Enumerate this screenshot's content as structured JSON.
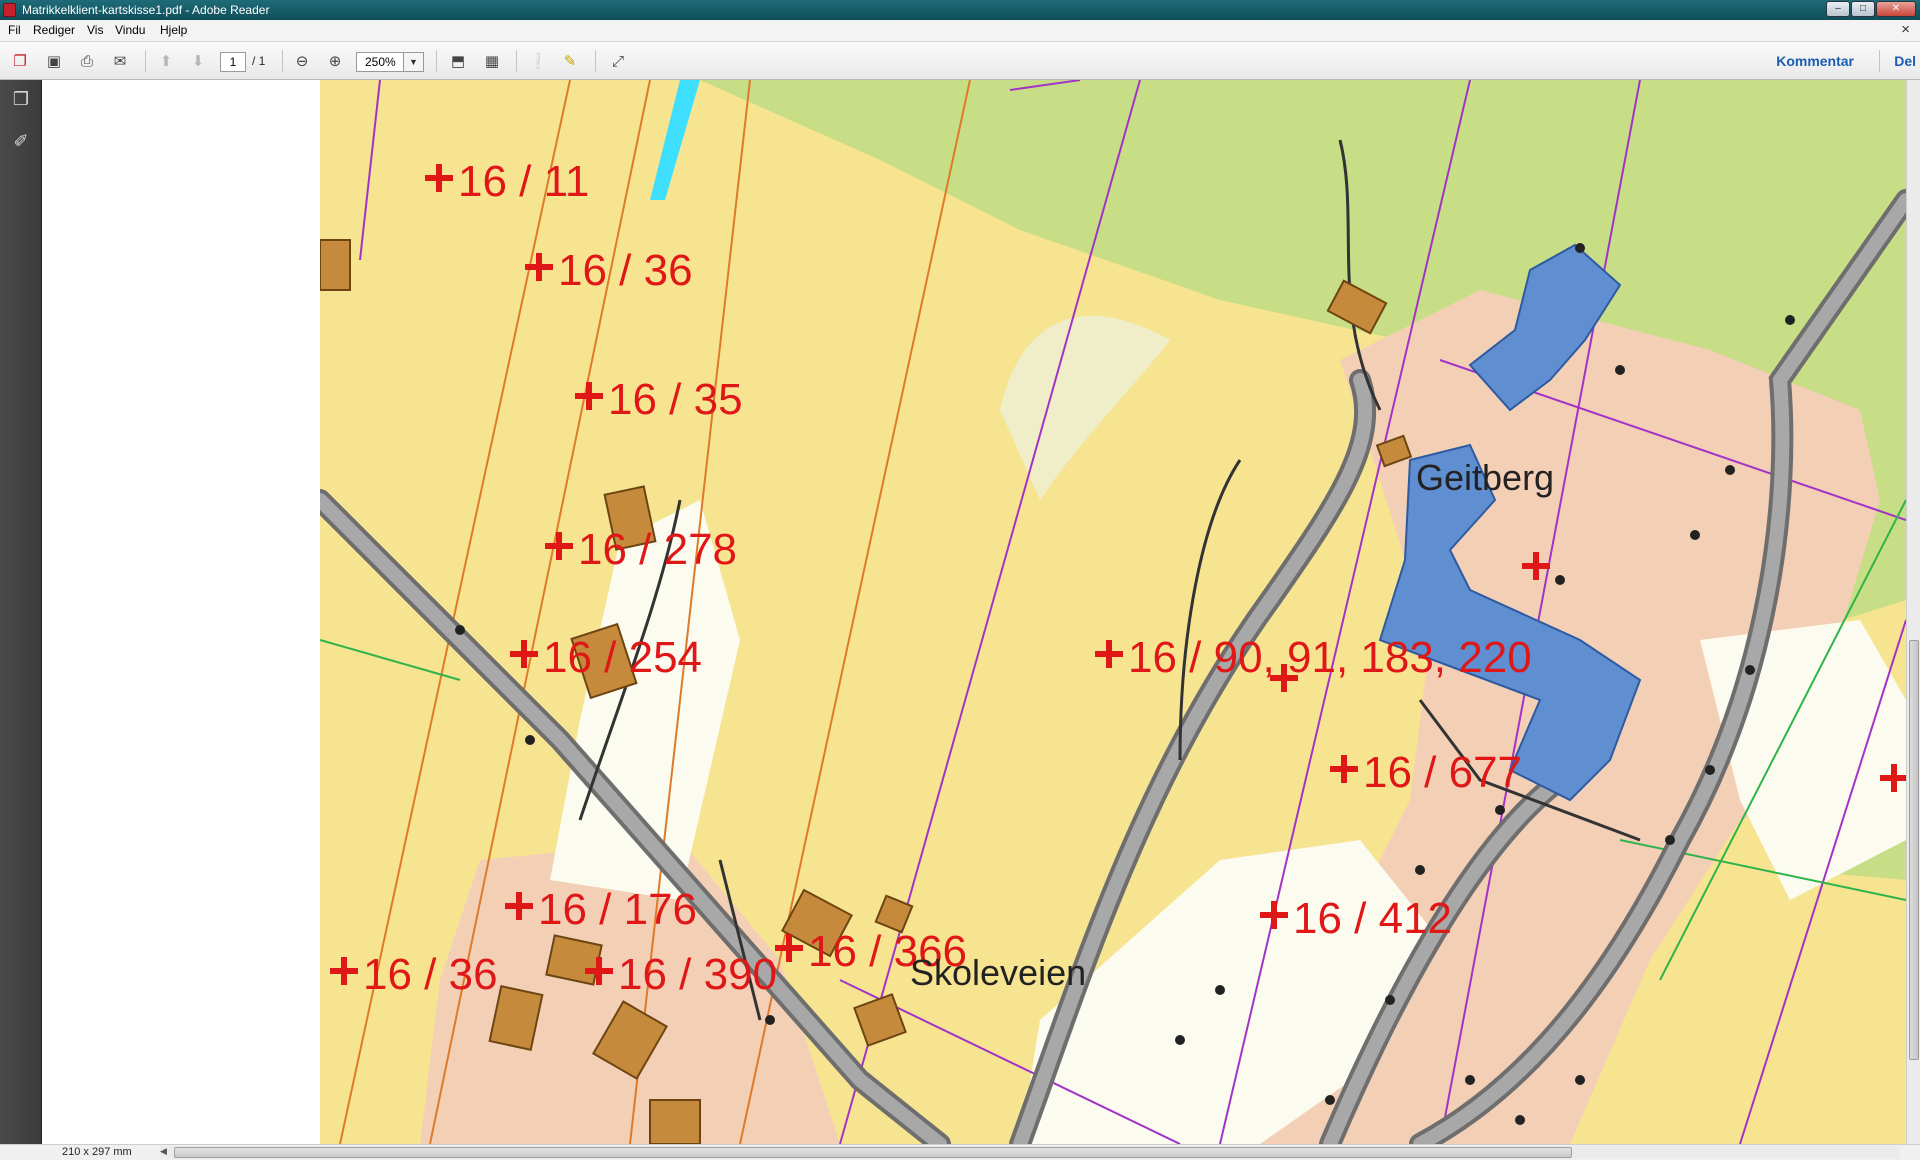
{
  "window": {
    "title": "Matrikkelklient-kartskisse1.pdf - Adobe Reader"
  },
  "menu": {
    "items": [
      "Fil",
      "Rediger",
      "Vis",
      "Vindu",
      "Hjelp"
    ],
    "close_glyph": "×"
  },
  "toolbar": {
    "page_current": "1",
    "page_total": "/ 1",
    "zoom": "250%",
    "comment_label": "Kommentar",
    "share_label": "Del"
  },
  "status": {
    "page_size": "210 x 297 mm"
  },
  "colors": {
    "map_yellow": "#f7e491",
    "map_green": "#c7dd86",
    "map_pink": "#f3cfb6",
    "map_white": "#fbfbf0",
    "building_blue": "#5f8fd0",
    "building_brown": "#c58a3b",
    "road_grey": "#9b9b9b",
    "parcel_red": "#e01717",
    "boundary_purple": "#a332c8"
  },
  "map": {
    "parcel_labels": [
      "16 / 11",
      "16 / 36",
      "16 / 35",
      "16 / 278",
      "16 / 254",
      "16 / 176",
      "16 / 36",
      "16 / 390",
      "16 / 366",
      "16 / 90, 91, 183, 220",
      "16 / 677",
      "16 / 412"
    ],
    "place_names": [
      "Geitberg",
      "Skoleveien"
    ]
  }
}
